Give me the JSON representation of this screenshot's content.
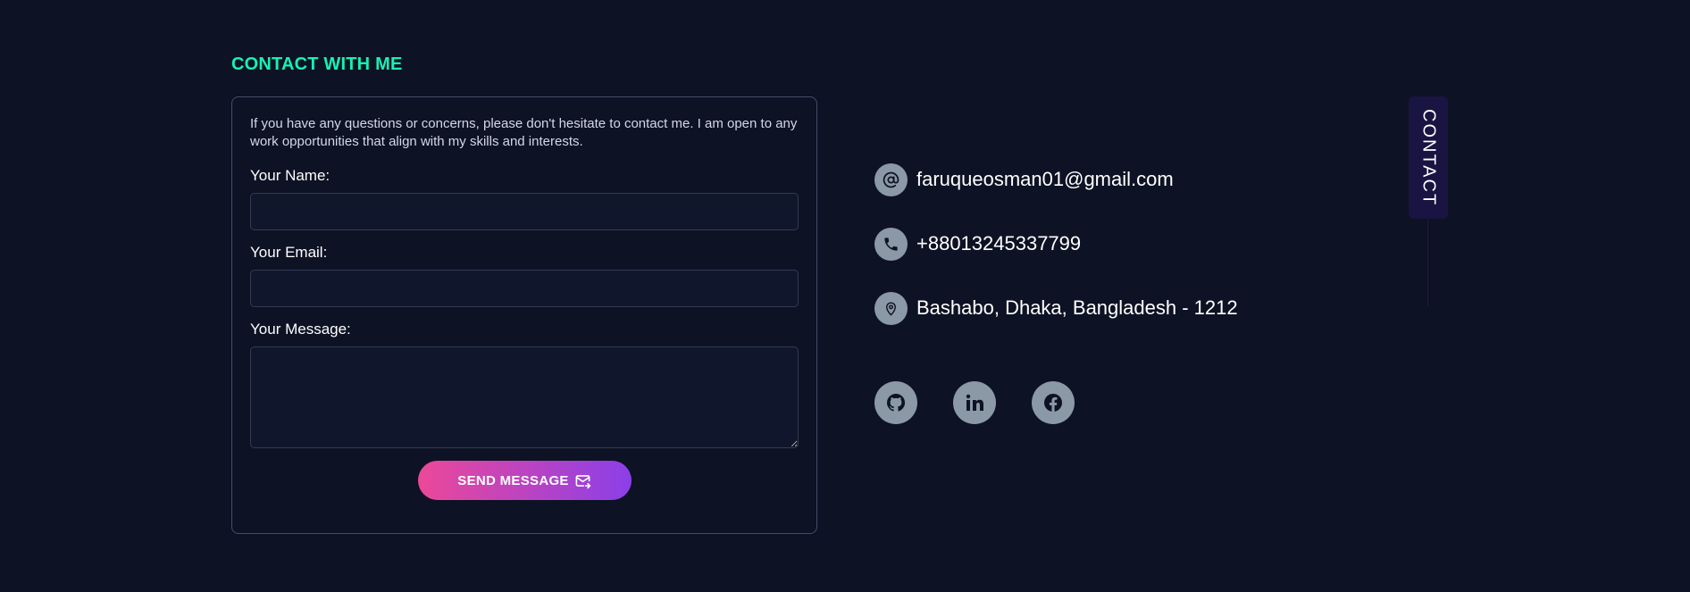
{
  "section": {
    "title": "CONTACT WITH ME"
  },
  "form": {
    "intro": "If you have any questions or concerns, please don't hesitate to contact me. I am open to any work opportunities that align with my skills and interests.",
    "name_label": "Your Name:",
    "name_value": "",
    "email_label": "Your Email:",
    "email_value": "",
    "message_label": "Your Message:",
    "message_value": "",
    "send_label": "SEND MESSAGE"
  },
  "contact_info": {
    "email": "faruqueosman01@gmail.com",
    "phone": "+88013245337799",
    "address": "Bashabo, Dhaka, Bangladesh - 1212"
  },
  "icons": {
    "email": "at-icon",
    "phone": "phone-icon",
    "address": "location-pin-icon",
    "send": "mail-send-icon",
    "social": [
      "github-icon",
      "linkedin-icon",
      "facebook-icon"
    ]
  },
  "side_tab": {
    "label": "CONTACT"
  },
  "colors": {
    "background": "#0d1224",
    "accent_title": "#16f2b3",
    "button_gradient_start": "#ec4899",
    "button_gradient_end": "#8b3fe8",
    "icon_circle": "#8b98a5",
    "side_tab_bg": "#1a1443"
  }
}
